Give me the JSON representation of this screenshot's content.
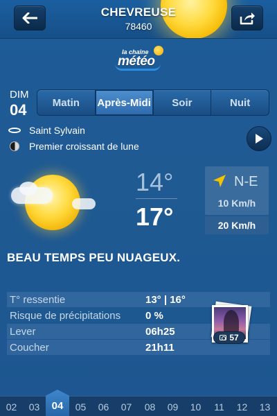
{
  "header": {
    "city": "CHEVREUSE",
    "postcode": "78460",
    "back_icon": "arrow-left-icon",
    "share_icon": "share-icon"
  },
  "logo": {
    "top": "la chaîne",
    "main": "météo"
  },
  "date": {
    "day": "DIM",
    "num": "04"
  },
  "periods": [
    "Matin",
    "Après-Midi",
    "Soir",
    "Nuit"
  ],
  "active_period": "Après-Midi",
  "saint": "Saint Sylvain",
  "moon": "Premier croissant de lune",
  "temps": {
    "min": "14°",
    "max": "17°"
  },
  "wind": {
    "direction": "N-E",
    "speed": "10 Km/h",
    "gust": "20 Km/h"
  },
  "description": "BEAU TEMPS PEU NUAGEUX.",
  "details": [
    {
      "label": "T° ressentie",
      "value": "13° | 16°"
    },
    {
      "label": "Risque de précipitations",
      "value": "0 %"
    },
    {
      "label": "Lever",
      "value": "06h25"
    },
    {
      "label": "Coucher",
      "value": "21h11"
    }
  ],
  "photos": {
    "count": "57"
  },
  "days": [
    "02",
    "03",
    "04",
    "05",
    "06",
    "07",
    "08",
    "09",
    "10",
    "11",
    "12",
    "13"
  ],
  "active_day": "04",
  "colors": {
    "background": "#1f5a93",
    "sun": "#ffd83a",
    "wind_arrow": "#f5c400"
  }
}
